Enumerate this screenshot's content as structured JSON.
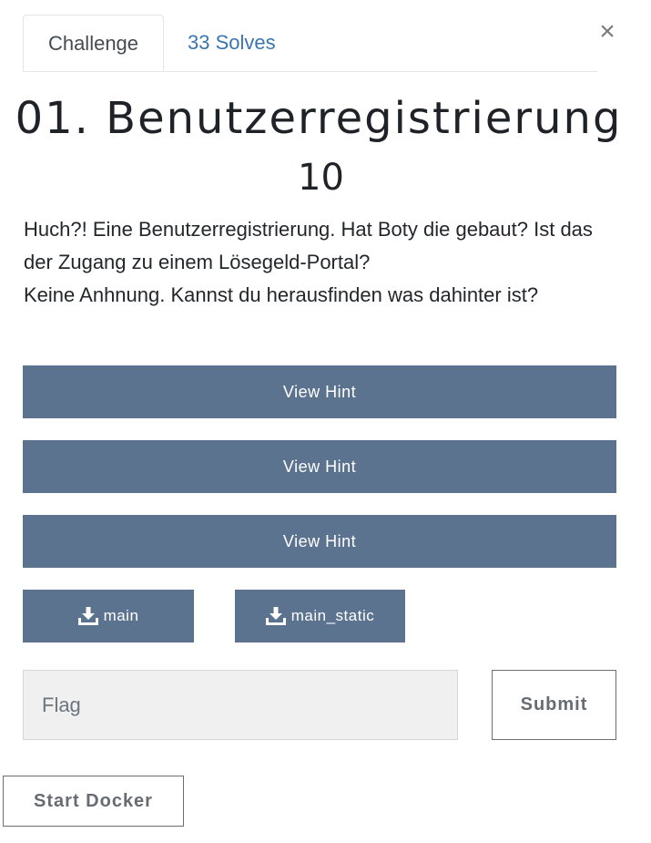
{
  "tabs": {
    "challenge": "Challenge",
    "solves": "33 Solves"
  },
  "close_icon": "×",
  "challenge": {
    "title": "01. Benutzerregistrierung",
    "points": "10",
    "description_lines": [
      "Huch?! Eine Benutzerregistrierung. Hat Boty die gebaut? Ist das der Zugang zu einem Lösegeld-Portal?",
      "Keine Anhnung. Kannst du  herausfinden was dahinter ist?"
    ]
  },
  "hints": [
    {
      "label": "View Hint"
    },
    {
      "label": "View Hint"
    },
    {
      "label": "View Hint"
    }
  ],
  "files": [
    {
      "label": "main",
      "icon": "download-icon"
    },
    {
      "label": "main_static",
      "icon": "download-icon"
    }
  ],
  "flag_form": {
    "placeholder": "Flag",
    "value": "",
    "submit_label": "Submit"
  },
  "docker": {
    "label": "Start Docker"
  },
  "colors": {
    "hint_button": "#5c7390",
    "tab_link": "#3b75ae"
  }
}
